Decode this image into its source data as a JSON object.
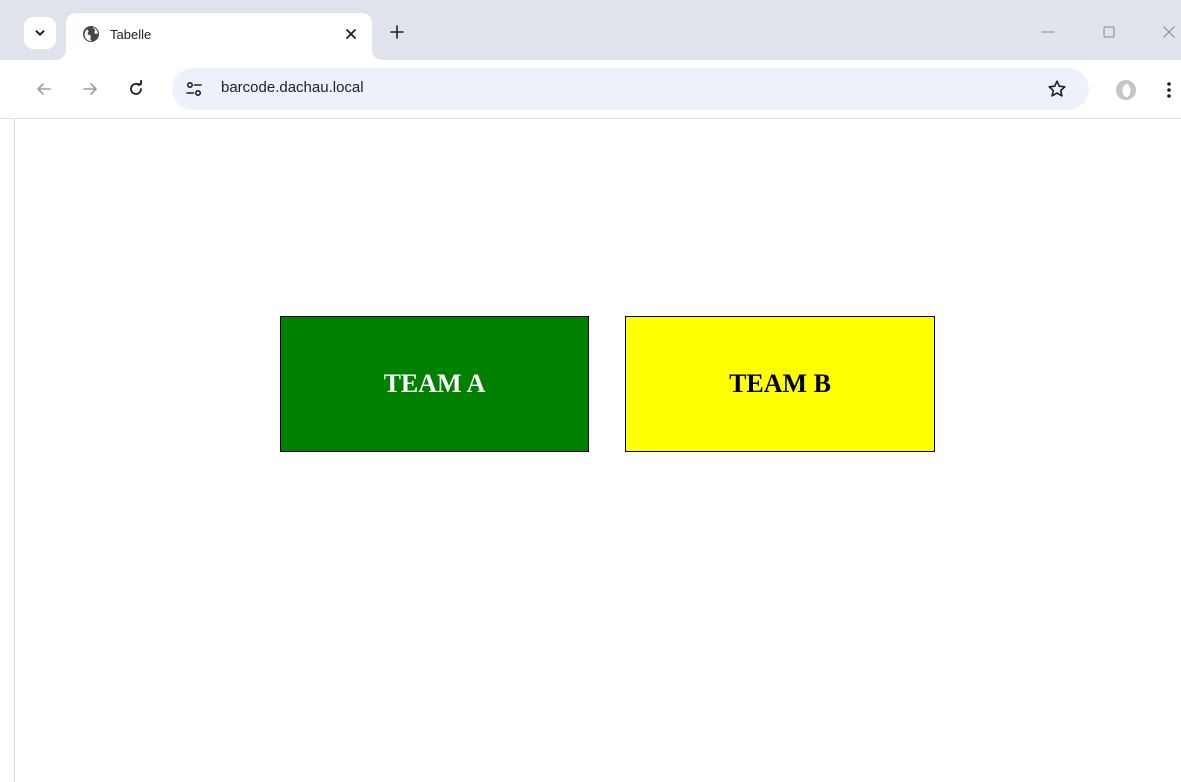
{
  "browser": {
    "tab_title": "Tabelle",
    "url": "barcode.dachau.local",
    "new_tab_symbol": "+"
  },
  "page": {
    "team_a": {
      "label": "TEAM A",
      "background": "#008000",
      "text_color": "#ffffff"
    },
    "team_b": {
      "label": "TEAM B",
      "background": "#ffff00",
      "text_color": "#000000"
    }
  },
  "icons": {
    "tab_search": "chevron-down-icon",
    "favicon": "globe-icon",
    "tab_close": "close-icon",
    "new_tab": "plus-icon",
    "minimize": "minimize-icon",
    "maximize": "maximize-icon",
    "window_close": "close-icon",
    "back": "arrow-left-icon",
    "forward": "arrow-right-icon",
    "reload": "reload-icon",
    "site_info": "tune-icon",
    "bookmark": "star-icon",
    "profile": "profile-icon",
    "menu": "more-vert-icon"
  }
}
